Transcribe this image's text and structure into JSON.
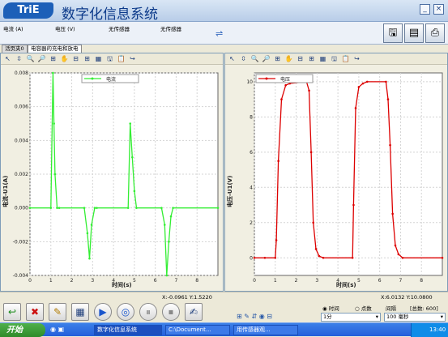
{
  "app": {
    "logo_text": "TriE",
    "title": "数字化信息系统"
  },
  "window_buttons": {
    "minimize": "_",
    "close": "×"
  },
  "sensors": [
    "电流 (A)",
    "电压 (V)",
    "无传感器",
    "无传感器"
  ],
  "tabs": [
    {
      "label": "活页夹0"
    },
    {
      "label": "电容器的充电和放电"
    }
  ],
  "panel_tool_icons": [
    "↖",
    "⇳",
    "🔍",
    "🔎",
    "⊞",
    "✋",
    "⊟",
    "⊞",
    "▦",
    "🖫",
    "📋",
    "↪"
  ],
  "left_chart": {
    "ylabel": "电流-U1(A)",
    "xlabel": "时间(s)",
    "legend": "电流",
    "coord_text": "X:-0.0961  Y:1.5220"
  },
  "right_chart": {
    "ylabel": "电压-U1(V)",
    "xlabel": "时间(s)",
    "legend": "电压",
    "coord_text": "X:6.0132  Y:10.0800"
  },
  "chart_data": [
    {
      "type": "line",
      "title": "",
      "xlabel": "时间(s)",
      "ylabel": "电流-U1(A)",
      "xlim": [
        0,
        9
      ],
      "ylim": [
        -0.004,
        0.008
      ],
      "xticks": [
        0,
        1,
        2,
        3,
        4,
        5,
        6,
        7,
        8
      ],
      "yticks": [
        -0.004,
        -0.002,
        0.0,
        0.002,
        0.004,
        0.006,
        0.008
      ],
      "ytick_labels": [
        "-0.004",
        "-0.002",
        "0.000",
        "0.002",
        "0.004",
        "0.006",
        "0.008"
      ],
      "grid": true,
      "legend_position": "top-center",
      "series": [
        {
          "name": "电流",
          "color": "#33ee33",
          "x": [
            0,
            1.0,
            1.1,
            1.15,
            1.2,
            1.3,
            1.4,
            2.6,
            2.75,
            2.85,
            2.95,
            3.1,
            3.2,
            4.7,
            4.8,
            4.9,
            5.0,
            5.1,
            6.3,
            6.45,
            6.55,
            6.65,
            6.75,
            6.85,
            9
          ],
          "y": [
            0.0,
            0.0,
            0.008,
            0.005,
            0.002,
            0.0,
            0.0,
            0.0,
            -0.0015,
            -0.003,
            -0.001,
            0.0,
            0.0,
            0.0,
            0.005,
            0.003,
            0.001,
            0.0,
            0.0,
            -0.001,
            -0.004,
            -0.002,
            -0.0005,
            0.0,
            0.0
          ]
        }
      ]
    },
    {
      "type": "line",
      "title": "",
      "xlabel": "时间(s)",
      "ylabel": "电压-U1(V)",
      "xlim": [
        0,
        9
      ],
      "ylim": [
        -1,
        10.5
      ],
      "xticks": [
        0,
        1,
        2,
        3,
        4,
        5,
        6,
        7,
        8
      ],
      "yticks": [
        0,
        2,
        4,
        6,
        8,
        10
      ],
      "ytick_labels": [
        "0",
        "2",
        "4",
        "6",
        "8",
        "10"
      ],
      "grid": true,
      "legend_position": "top-left",
      "series": [
        {
          "name": "电压",
          "color": "#dd0000",
          "x": [
            0,
            0.5,
            1.0,
            1.05,
            1.15,
            1.3,
            1.5,
            1.7,
            2.5,
            2.62,
            2.72,
            2.82,
            2.95,
            3.1,
            3.3,
            4.7,
            4.75,
            4.85,
            5.0,
            5.2,
            5.4,
            6.3,
            6.4,
            6.5,
            6.62,
            6.75,
            6.9,
            7.1,
            9
          ],
          "y": [
            0.0,
            0.0,
            0.0,
            1.0,
            5.5,
            9.0,
            9.8,
            9.9,
            10.0,
            9.5,
            6.0,
            2.0,
            0.5,
            0.1,
            0.0,
            0.0,
            3.0,
            8.5,
            9.7,
            9.9,
            10.0,
            10.0,
            9.0,
            6.4,
            2.5,
            0.7,
            0.2,
            0.0,
            0.0
          ]
        }
      ]
    }
  ],
  "controls": {
    "radio_time": "时间",
    "radio_points": "点数",
    "interval_label": "间隔",
    "total_label": "[总数: 600]",
    "duration_value": "1分",
    "interval_value": "100 毫秒"
  },
  "control_buttons": [
    "↩",
    "✖",
    "✎",
    "▦",
    "▶",
    "◎",
    "⏸",
    "⏹",
    "✍"
  ],
  "taskbar": {
    "start": "开始",
    "tasks": [
      "数字化信息系统",
      "C:\\Document...",
      "用传感器观..."
    ],
    "time": "13:40"
  },
  "colors": {
    "current": "#33ee33",
    "voltage": "#dd0000",
    "title": "#0c3a8a",
    "taskbar": "#245edb"
  }
}
